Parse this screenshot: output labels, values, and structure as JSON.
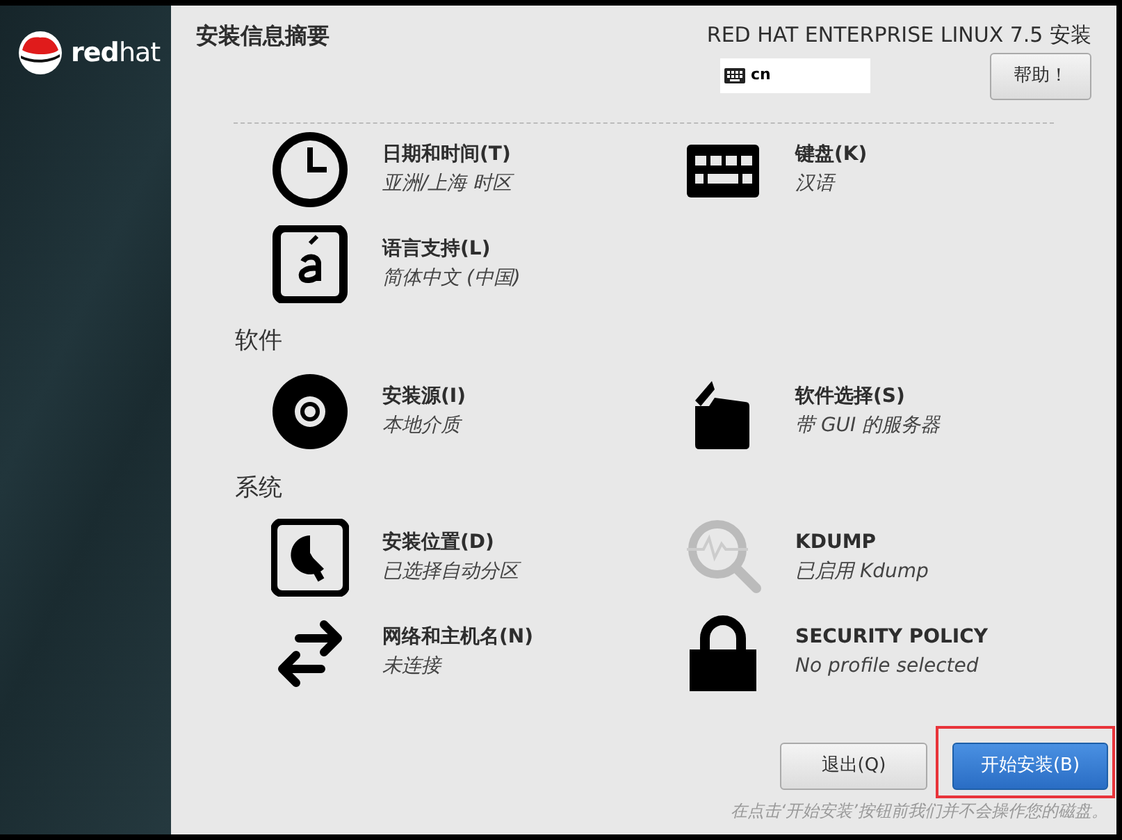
{
  "sidebar": {
    "logo_text": "**red**hat"
  },
  "header": {
    "title": "安装信息摘要",
    "product": "RED HAT ENTERPRISE LINUX 7.5 安装",
    "keyboard_layout": "cn",
    "help_button": "帮助！"
  },
  "sections": [
    {
      "spokes": [
        {
          "kind": "clock",
          "title": "日期和时间(T)",
          "status": "亚洲/上海 时区"
        },
        {
          "kind": "keyboard",
          "title": "键盘(K)",
          "status": "汉语"
        },
        {
          "kind": "language",
          "title": "语言支持(L)",
          "status": "简体中文 (中国)"
        }
      ]
    },
    {
      "heading": "软件",
      "spokes": [
        {
          "kind": "disc",
          "title": "安装源(I)",
          "status": "本地介质"
        },
        {
          "kind": "package",
          "title": "软件选择(S)",
          "status": "带 GUI 的服务器"
        }
      ]
    },
    {
      "heading": "系统",
      "spokes": [
        {
          "kind": "disk",
          "title": "安装位置(D)",
          "status": "已选择自动分区"
        },
        {
          "kind": "search",
          "title": "KDUMP",
          "status": "已启用 Kdump"
        },
        {
          "kind": "network",
          "title": "网络和主机名(N)",
          "status": "未连接"
        },
        {
          "kind": "lock",
          "title": "SECURITY POLICY",
          "status": "No profile selected"
        }
      ]
    }
  ],
  "buttons": [
    {
      "label": "退出(Q)",
      "kind": "secondary",
      "highlighted": false
    },
    {
      "label": "开始安装(B)",
      "kind": "primary",
      "highlighted": true
    }
  ],
  "hint": "在点击‘开始安装’按钮前我们并不会操作您的磁盘。"
}
